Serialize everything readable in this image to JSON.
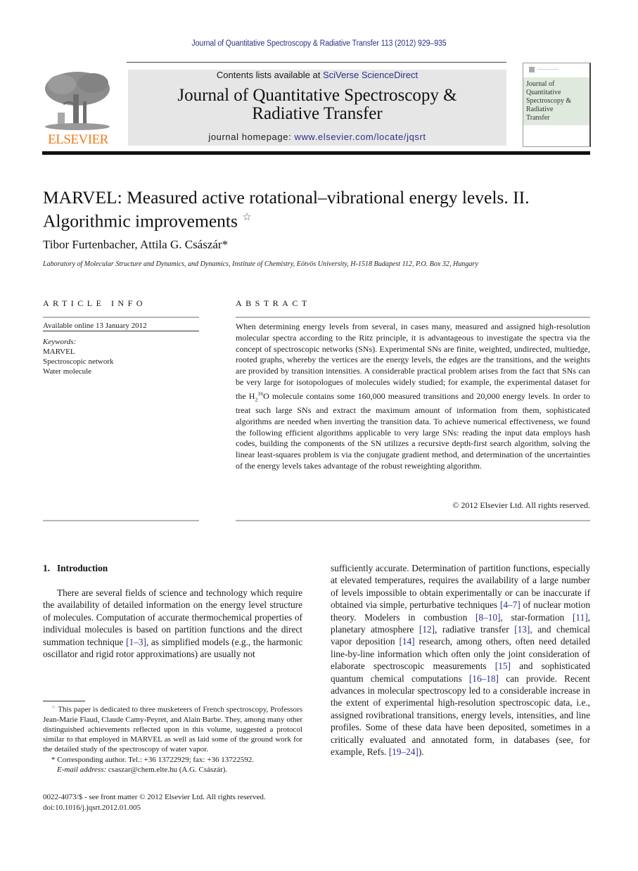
{
  "header": {
    "running_head": "Journal of Quantitative Spectroscopy & Radiative Transfer 113 (2012) 929–935",
    "contents_prefix": "Contents lists available at ",
    "contents_link": "SciVerse ScienceDirect",
    "journal_title_line1": "Journal of Quantitative Spectroscopy &",
    "journal_title_line2": "Radiative Transfer",
    "homepage_prefix": "journal homepage: ",
    "homepage_link": "www.elsevier.com/locate/jqsrt",
    "publisher_logo": "ELSEVIER",
    "cover_lines": [
      "Journal of",
      "Quantitative",
      "Spectroscopy &",
      "Radiative",
      "Transfer"
    ],
    "colors": {
      "link": "#2b2f8a",
      "elsevier_orange": "#f07a1c",
      "banner_bg": "#e6e6e6",
      "cover_band": "#dfe9dd"
    }
  },
  "article": {
    "title_line1": "MARVEL: Measured active rotational–vibrational energy levels. II.",
    "title_line2": "Algorithmic improvements",
    "title_note_mark": "☆",
    "authors": "Tibor Furtenbacher, Attila G. Császár",
    "author_mark": "*",
    "affiliation": "Laboratory of Molecular Structure and Dynamics, and Dynamics, Institute of Chemistry, Eötvös University, H-1518 Budapest 112, P.O. Box 32, Hungary"
  },
  "article_info": {
    "heading": "ARTICLE INFO",
    "available_online": "Available online 13 January 2012",
    "keywords_label": "Keywords:",
    "keywords": [
      "MARVEL",
      "Spectroscopic network",
      "Water molecule"
    ]
  },
  "abstract": {
    "heading": "ABSTRACT",
    "text_part1": "When determining energy levels from several, in cases many, measured and assigned high-resolution molecular spectra according to the Ritz principle, it is advantageous to investigate the spectra via the concept of spectroscopic networks (SNs). Experimental SNs are finite, weighted, undirected, multiedge, rooted graphs, whereby the vertices are the energy levels, the edges are the transitions, and the weights are provided by transition intensities. A considerable practical problem arises from the fact that SNs can be very large for isotopologues of molecules widely studied; for example, the experimental dataset for the H",
    "sub": "2",
    "sup": "16",
    "text_part2": "O molecule contains some 160,000 measured transitions and 20,000 energy levels. In order to treat such large SNs and extract the maximum amount of information from them, sophisticated algorithms are needed when inverting the transition data. To achieve numerical effectiveness, we found the following efficient algorithms applicable to very large SNs: reading the input data employs hash codes, building the components of the SN utilizes a recursive depth-first search algorithm, solving the linear least-squares problem is via the conjugate gradient method, and determination of the uncertainties of the energy levels takes advantage of the robust reweighting algorithm.",
    "copyright": "© 2012 Elsevier Ltd. All rights reserved."
  },
  "introduction": {
    "heading": "1.  Introduction",
    "col1_a": "There are several fields of science and technology which require the availability of detailed information on the energy level structure of molecules. Computation of accurate thermochemical properties of individual molecules is based on partition functions and the direct summation technique ",
    "ref_1_3": "[1–3]",
    "col1_b": ", as simplified models (e.g., the harmonic oscillator and rigid rotor approximations) are usually not",
    "col2_a": "sufficiently accurate. Determination of partition functions, especially at elevated temperatures, requires the availability of a large number of levels impossible to obtain experimentally or can be inaccurate if obtained via simple, perturbative techniques ",
    "ref_4_7": "[4–7]",
    "col2_b": " of nuclear motion theory. Modelers in combustion ",
    "ref_8_10": "[8–10]",
    "col2_c": ", star-formation ",
    "ref_11": "[11]",
    "col2_d": ", planetary atmosphere ",
    "ref_12": "[12]",
    "col2_e": ", radiative transfer ",
    "ref_13": "[13]",
    "col2_f": ", and chemical vapor deposition ",
    "ref_14": "[14]",
    "col2_g": " research, among others, often need detailed line-by-line information which often only the joint consideration of elaborate spectroscopic measurements ",
    "ref_15": "[15]",
    "col2_h": " and sophisticated quantum chemical computations ",
    "ref_16_18": "[16–18]",
    "col2_i": " can provide. Recent advances in molecular spectroscopy led to a considerable increase in the extent of experimental high-resolution spectroscopic data, i.e., assigned rovibrational transitions, energy levels, intensities, and line profiles. Some of these data have been deposited, sometimes in a critically evaluated and annotated form, in databases (see, for example, Refs. ",
    "ref_19_24": "[19–24]",
    "col2_j": ")."
  },
  "footnotes": {
    "dedication_mark": "☆",
    "dedication": "This paper is dedicated to three musketeers of French spectroscopy, Professors Jean-Marie Flaud, Claude Camy-Peyret, and Alain Barbe. They, among many other distinguished achievements reflected upon in this volume, suggested a protocol similar to that employed in MARVEL as well as laid some of the ground work for the detailed study of the spectroscopy of water vapor.",
    "corresponding_mark": "*",
    "corresponding": "Corresponding author. Tel.: +36 13722929; fax: +36 13722592.",
    "email_label": "E-mail address:",
    "email": "csaszar@chem.elte.hu (A.G. Császár).",
    "front_matter": "0022-4073/$ - see front matter © 2012 Elsevier Ltd. All rights reserved.",
    "doi": "doi:10.1016/j.jqsrt.2012.01.005"
  }
}
